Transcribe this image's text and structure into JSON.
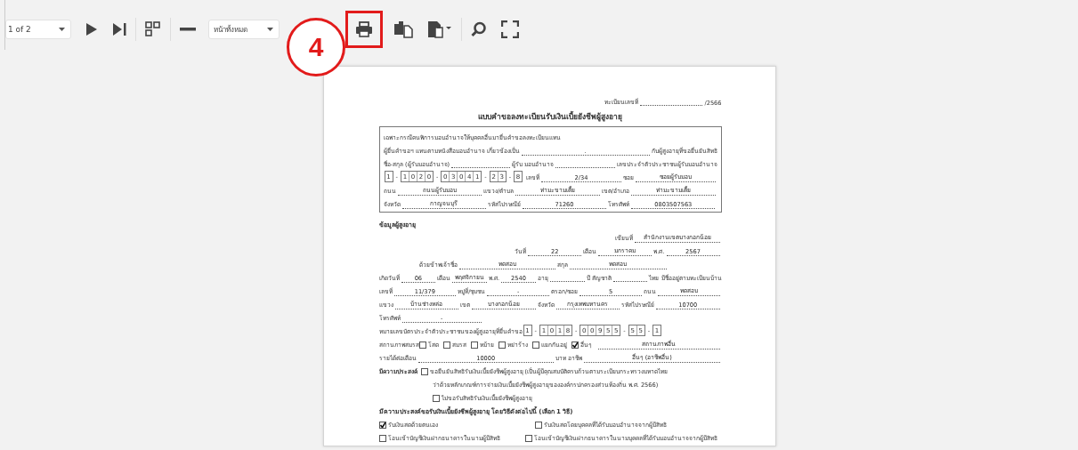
{
  "toolbar": {
    "page_select": {
      "value": "1 of 2"
    },
    "buttons": [
      {
        "kind": "play",
        "highlighted": false
      },
      {
        "kind": "last",
        "highlighted": false
      },
      {
        "kind": "pages",
        "highlighted": false
      },
      {
        "kind": "zoom_out",
        "highlighted": false
      }
    ],
    "view_select": {
      "value": "หน้าทั้งหมด"
    },
    "actions": [
      {
        "kind": "print",
        "highlighted": true
      },
      {
        "kind": "export",
        "highlighted": false
      },
      {
        "kind": "export_menu",
        "highlighted": false
      },
      {
        "kind": "search",
        "highlighted": false
      },
      {
        "kind": "fullscreen",
        "highlighted": false
      }
    ]
  },
  "annotation": {
    "label": "4"
  },
  "document": {
    "header_lines": [
      {
        "kind": "right",
        "segments": [
          {
            "kind": "label",
            "text": "ทะเบียนเลขที่"
          },
          {
            "kind": "blank"
          },
          {
            "kind": "label",
            "text": "/2566"
          }
        ]
      },
      {
        "kind": "title",
        "segments": [
          {
            "kind": "label",
            "text": "แบบคำขอลงทะเบียนรับเงินเบี้ยยังชีพผู้สูงอายุ"
          }
        ]
      }
    ],
    "authorization_box": {
      "lines": [
        {
          "kind": "text",
          "segments": [
            {
              "kind": "label",
              "text": "เฉพาะกรณีคนพิการมอบอำนาจให้บุคคลอื่นมายื่นคำขอลงทะเบียนแทน"
            }
          ]
        },
        {
          "kind": "text",
          "segments": [
            {
              "kind": "label",
              "text": "ผู้ยื่นคำขอฯ แทนตามหนังสือมอบอำนาจ เกี่ยวข้องเป็น"
            },
            {
              "kind": "value",
              "text": "."
            },
            {
              "kind": "label",
              "text": "กับผู้สูงอายุที่ขอยื่นยันสิทธิ"
            }
          ]
        },
        {
          "kind": "text",
          "segments": [
            {
              "kind": "label",
              "text": "ชื่อ-สกุล (ผู้รับมอบอำนาจ)"
            },
            {
              "kind": "blank"
            },
            {
              "kind": "label",
              "text": "ผู้รับ มอบอำนาจ"
            },
            {
              "kind": "blank"
            },
            {
              "kind": "label",
              "text": "เลขประจำตัวประชาชนผู้รับมอบอำนาจ"
            }
          ]
        },
        {
          "kind": "text",
          "segments": [
            {
              "kind": "digits",
              "separator": "-",
              "groups": [
                [
                  "1"
                ],
                [
                  "1",
                  "0",
                  "2",
                  "0"
                ],
                [
                  "0",
                  "3",
                  "0",
                  "4",
                  "1"
                ],
                [
                  "2",
                  "3"
                ],
                [
                  "8"
                ]
              ]
            },
            {
              "kind": "label",
              "text": "เลขที่"
            },
            {
              "kind": "value",
              "text": "2/34"
            },
            {
              "kind": "label",
              "text": "ซอย"
            },
            {
              "kind": "value",
              "text": "ซอยผู้รับมอบ"
            }
          ]
        },
        {
          "kind": "text",
          "segments": [
            {
              "kind": "label",
              "text": "ถนน"
            },
            {
              "kind": "value",
              "text": "ถนนผู้รับมอบ"
            },
            {
              "kind": "label",
              "text": "แขวง/ตำบล"
            },
            {
              "kind": "value",
              "text": "ท่ามะขามเตี้ย"
            },
            {
              "kind": "label",
              "text": "เขต/อำเภอ"
            },
            {
              "kind": "value",
              "text": "ท่ามะขามเตี้ย"
            }
          ]
        },
        {
          "kind": "text",
          "segments": [
            {
              "kind": "label",
              "text": "จังหวัด"
            },
            {
              "kind": "value",
              "text": "กาญจนบุรี"
            },
            {
              "kind": "label",
              "text": "รหัสไปรษณีย์"
            },
            {
              "kind": "value",
              "text": "71260"
            },
            {
              "kind": "label",
              "text": "โทรศัพท์"
            },
            {
              "kind": "value",
              "text": "0803507563"
            }
          ]
        }
      ]
    },
    "lines": [
      {
        "kind": "heading",
        "segments": [
          {
            "kind": "label",
            "text": "ข้อมูลผู้สูงอายุ"
          }
        ]
      },
      {
        "kind": "right",
        "segments": [
          {
            "kind": "label",
            "text": "เขียนที่"
          },
          {
            "kind": "value",
            "text": "สำนักงานเขตบางกอกน้อย"
          }
        ]
      },
      {
        "kind": "right",
        "segments": [
          {
            "kind": "label",
            "text": "วันที่"
          },
          {
            "kind": "value",
            "text": "22"
          },
          {
            "kind": "label",
            "text": "เดือน"
          },
          {
            "kind": "value",
            "text": "มกราคม"
          },
          {
            "kind": "label",
            "text": "พ.ศ."
          },
          {
            "kind": "value",
            "text": "2567"
          }
        ]
      },
      {
        "kind": "indent",
        "segments": [
          {
            "kind": "label",
            "text": "ด้วยข้าพเจ้าชื่อ"
          },
          {
            "kind": "value",
            "text": "ทดสอบ"
          },
          {
            "kind": "label",
            "text": "สกุล"
          },
          {
            "kind": "value",
            "text": "ทดสอบ"
          }
        ]
      },
      {
        "kind": "text",
        "segments": [
          {
            "kind": "label",
            "text": "เกิดวันที่"
          },
          {
            "kind": "value",
            "text": "06"
          },
          {
            "kind": "label",
            "text": "เดือน"
          },
          {
            "kind": "value",
            "text": "พฤศจิกายน"
          },
          {
            "kind": "label",
            "text": "พ.ศ."
          },
          {
            "kind": "value",
            "text": "2540"
          },
          {
            "kind": "label",
            "text": "อายุ"
          },
          {
            "kind": "blank"
          },
          {
            "kind": "label",
            "text": "ปี สัญชาติ"
          },
          {
            "kind": "blank"
          },
          {
            "kind": "label",
            "text": "ไทย มีชื่ออยู่ตามทะเบียนบ้าน"
          }
        ]
      },
      {
        "kind": "text",
        "segments": [
          {
            "kind": "label",
            "text": "เลขที่"
          },
          {
            "kind": "value",
            "text": "11/379"
          },
          {
            "kind": "label",
            "text": "หมู่ที่/ชุมชน"
          },
          {
            "kind": "value",
            "text": "-"
          },
          {
            "kind": "label",
            "text": "ตรอก/ซอย"
          },
          {
            "kind": "value",
            "text": "5"
          },
          {
            "kind": "label",
            "text": "ถนน"
          },
          {
            "kind": "value",
            "text": "ทดสอบ"
          }
        ]
      },
      {
        "kind": "text",
        "segments": [
          {
            "kind": "label",
            "text": "แขวง"
          },
          {
            "kind": "value",
            "text": "บ้านช่างหล่อ"
          },
          {
            "kind": "label",
            "text": "เขต"
          },
          {
            "kind": "value",
            "text": "บางกอกน้อย"
          },
          {
            "kind": "label",
            "text": "จังหวัด"
          },
          {
            "kind": "value",
            "text": "กรุงเทพมหานคร"
          },
          {
            "kind": "label",
            "text": "รหัสไปรษณีย์"
          },
          {
            "kind": "value",
            "text": "10700"
          }
        ]
      },
      {
        "kind": "text",
        "segments": [
          {
            "kind": "label",
            "text": "โทรศัพท์"
          },
          {
            "kind": "value",
            "text": "-"
          },
          {
            "kind": "spacer"
          }
        ]
      },
      {
        "kind": "text",
        "segments": [
          {
            "kind": "label",
            "text": "หมายเลขบัตรประจำตัวประชาชนของผู้สูงอายุที่ยื่นคำขอ"
          },
          {
            "kind": "digits",
            "separator": "-",
            "groups": [
              [
                "1"
              ],
              [
                "1",
                "0",
                "1",
                "8"
              ],
              [
                "0",
                "0",
                "9",
                "5",
                "5"
              ],
              [
                "5",
                "5"
              ],
              [
                "1"
              ]
            ]
          }
        ]
      },
      {
        "kind": "text",
        "segments": [
          {
            "kind": "label",
            "text": "สถานภาพสมรส"
          },
          {
            "kind": "check",
            "text": "โสด",
            "checked": false
          },
          {
            "kind": "check",
            "text": "สมรส",
            "checked": false
          },
          {
            "kind": "check",
            "text": "หม้าย",
            "checked": false
          },
          {
            "kind": "check",
            "text": "หย่าร้าง",
            "checked": false
          },
          {
            "kind": "check",
            "text": "แยกกันอยู่",
            "checked": false
          },
          {
            "kind": "check",
            "text": "อื่นๆ",
            "checked": true
          },
          {
            "kind": "value",
            "text": "สถานภาพอื่น"
          }
        ]
      },
      {
        "kind": "text",
        "segments": [
          {
            "kind": "label",
            "text": "รายได้ต่อเดือน"
          },
          {
            "kind": "value",
            "text": "10000"
          },
          {
            "kind": "label",
            "text": "บาท อาชีพ"
          },
          {
            "kind": "value",
            "text": "อื่นๆ (อาชีพอื่น)"
          }
        ]
      },
      {
        "kind": "text",
        "segments": [
          {
            "kind": "bold",
            "text": "มีความประสงค์"
          },
          {
            "kind": "check",
            "text": "ขอยืนยันสิทธิรับเงินเบี้ยยังชีพผู้สูงอายุ (เป็นผู้มีคุณสมบัติครบถ้วนตามระเบียบกระทรวงมหาดไทย",
            "checked": false
          }
        ]
      },
      {
        "kind": "deep",
        "segments": [
          {
            "kind": "label",
            "text": "ว่าด้วยหลักเกณฑ์การจ่ายเงินเบี้ยยังชีพผู้สูงอายุขององค์กรปกครองส่วนท้องถิ่น พ.ศ. 2566)"
          }
        ]
      },
      {
        "kind": "deep",
        "segments": [
          {
            "kind": "check",
            "text": "ไม่ขอรับสิทธิรับเงินเบี้ยยังชีพผู้สูงอายุ",
            "checked": false
          }
        ]
      },
      {
        "kind": "heading",
        "segments": [
          {
            "kind": "label",
            "text": "มีความประสงค์ขอรับเงินเบี้ยยังชีพผู้สูงอายุ โดยวิธีดังต่อไปนี้ (เลือก 1 วิธี)"
          }
        ]
      },
      {
        "kind": "columns",
        "segments": [
          {
            "kind": "check",
            "text": "รับเงินสดด้วยตนเอง",
            "checked": true
          },
          {
            "kind": "check",
            "text": "รับเงินสดโดยบุคคลที่ได้รับมอบอำนาจจากผู้มีสิทธิ",
            "checked": false
          }
        ]
      },
      {
        "kind": "columns",
        "segments": [
          {
            "kind": "check",
            "text": "โอนเข้าบัญชีเงินฝากธนาคารในนามผู้มีสิทธิ",
            "checked": false
          },
          {
            "kind": "check",
            "text": "โอนเข้าบัญชีเงินฝากธนาคารในนามบุคคลที่ได้รับมอบอำนาจจากผู้มีสิทธิ",
            "checked": false
          }
        ]
      }
    ]
  }
}
